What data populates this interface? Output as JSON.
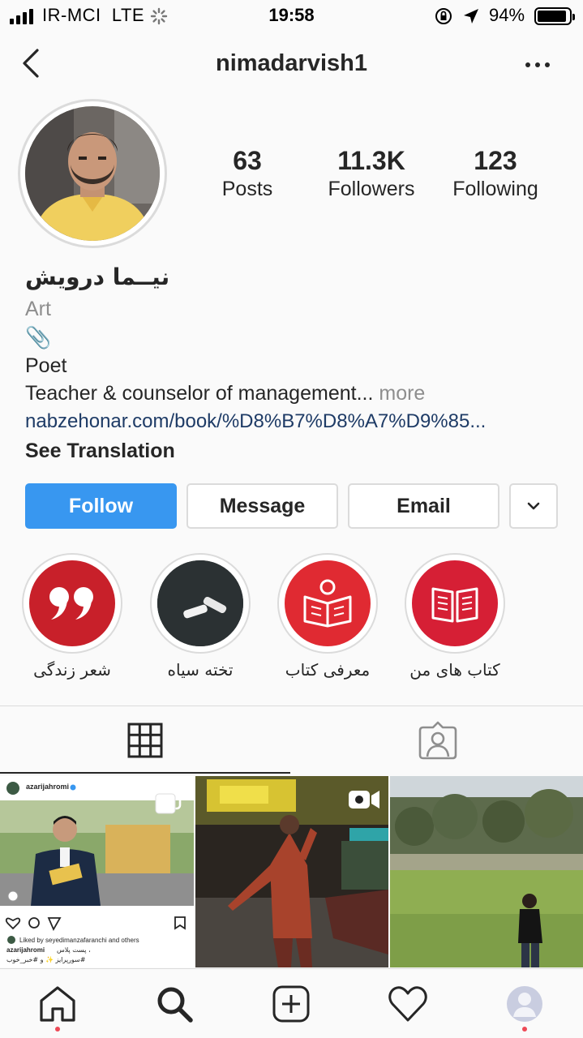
{
  "status_bar": {
    "carrier": "IR-MCI",
    "network": "LTE",
    "time": "19:58",
    "battery_percent": "94%",
    "battery_level": 0.94
  },
  "header": {
    "username": "nimadarvish1",
    "back_icon": "chevron-left-icon",
    "more_icon": "more-horizontal-icon"
  },
  "profile": {
    "stats": [
      {
        "value": "63",
        "label": "Posts"
      },
      {
        "value": "11.3K",
        "label": "Followers"
      },
      {
        "value": "123",
        "label": "Following"
      }
    ],
    "display_name": "نیــما درویش",
    "category": "Art",
    "bio_emoji": "📎",
    "bio_line1": "Poet",
    "bio_line2": "Teacher & counselor of management...",
    "more_label": "more",
    "link": "nabzehonar.com/book/%D8%B7%D8%A7%D9%85...",
    "see_translation": "See Translation"
  },
  "actions": {
    "follow": "Follow",
    "message": "Message",
    "email": "Email",
    "dropdown_icon": "chevron-down-icon"
  },
  "highlights": [
    {
      "label": "شعر زندگی",
      "icon": "quote-icon",
      "color": "#c8202a"
    },
    {
      "label": "تخته سیاه",
      "icon": "chalk-icon",
      "color": "#2b3133"
    },
    {
      "label": "معرفی کتاب",
      "icon": "reading-person-icon",
      "color": "#e02a32"
    },
    {
      "label": "کتاب های من",
      "icon": "open-book-icon",
      "color": "#d61f35"
    }
  ],
  "tabs": [
    {
      "name": "grid",
      "icon": "grid-icon",
      "active": true
    },
    {
      "name": "tagged",
      "icon": "tagged-person-icon",
      "active": false
    }
  ],
  "posts": [
    {
      "type": "multiple",
      "overlay_icon": "carousel-icon",
      "embedded_user": "azarijahromi",
      "embedded_liked": "Liked by seyedimanzafaranchi and others",
      "embedded_caption_user": "azarijahromi",
      "embedded_caption": "، پست پلاس",
      "embedded_tags": "#سورپرایز ✨ و #خبر_خوب"
    },
    {
      "type": "video",
      "overlay_icon": "video-camera-icon"
    },
    {
      "type": "photo"
    }
  ],
  "bottom_nav": [
    {
      "name": "home",
      "icon": "home-icon"
    },
    {
      "name": "search",
      "icon": "search-icon"
    },
    {
      "name": "new-post",
      "icon": "plus-square-icon"
    },
    {
      "name": "activity",
      "icon": "heart-icon"
    },
    {
      "name": "profile",
      "icon": "profile-avatar-icon"
    }
  ],
  "colors": {
    "follow_blue": "#3897f0",
    "link_blue": "#1e3b66",
    "notification_red": "#ed4956"
  }
}
